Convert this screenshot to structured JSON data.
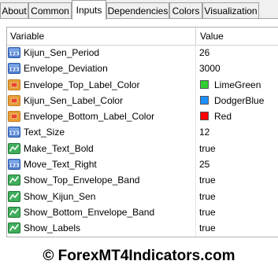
{
  "tabs": [
    {
      "label": "About",
      "active": false
    },
    {
      "label": "Common",
      "active": false
    },
    {
      "label": "Inputs",
      "active": true
    },
    {
      "label": "Dependencies",
      "active": false
    },
    {
      "label": "Colors",
      "active": false
    },
    {
      "label": "Visualization",
      "active": false
    }
  ],
  "grid": {
    "col_variable": "Variable",
    "col_value": "Value",
    "rows": [
      {
        "name": "Kijun_Sen_Period",
        "value": "26",
        "icon": "integer-icon"
      },
      {
        "name": "Envelope_Deviation",
        "value": "3000",
        "icon": "integer-icon"
      },
      {
        "name": "Envelope_Top_Label_Color",
        "value": "LimeGreen",
        "icon": "color-icon",
        "swatch": "#32cd32"
      },
      {
        "name": "Kijun_Sen_Label_Color",
        "value": "DodgerBlue",
        "icon": "color-icon",
        "swatch": "#1e90ff"
      },
      {
        "name": "Envelope_Bottom_Label_Color",
        "value": "Red",
        "icon": "color-icon",
        "swatch": "#ff0000"
      },
      {
        "name": "Text_Size",
        "value": "12",
        "icon": "integer-icon"
      },
      {
        "name": "Make_Text_Bold",
        "value": "true",
        "icon": "boolean-icon"
      },
      {
        "name": "Move_Text_Right",
        "value": "25",
        "icon": "integer-icon"
      },
      {
        "name": "Show_Top_Envelope_Band",
        "value": "true",
        "icon": "boolean-icon"
      },
      {
        "name": "Show_Kijun_Sen",
        "value": "true",
        "icon": "boolean-icon"
      },
      {
        "name": "Show_Bottom_Envelope_Band",
        "value": "true",
        "icon": "boolean-icon"
      },
      {
        "name": "Show_Labels",
        "value": "true",
        "icon": "boolean-icon"
      }
    ]
  },
  "footer": {
    "watermark": "© ForexMT4Indicators.com"
  }
}
